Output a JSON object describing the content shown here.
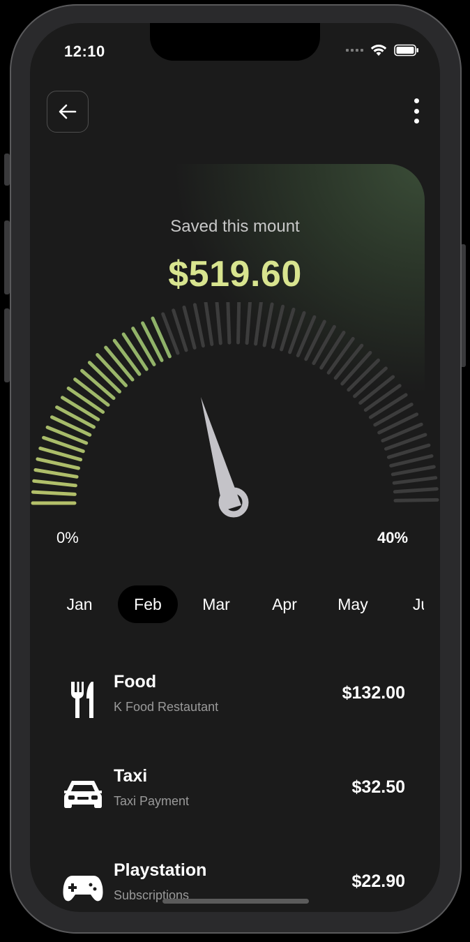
{
  "status_bar": {
    "time": "12:10"
  },
  "header": {
    "back_icon": "arrow-left-icon",
    "more_icon": "more-vertical-icon"
  },
  "summary": {
    "label": "Saved this mount",
    "amount": "$519.60",
    "accent_color": "#d8e48f",
    "gauge": {
      "min_label": "0%",
      "max_label": "40%",
      "filled_fraction": 0.38
    }
  },
  "months": {
    "items": [
      "Jan",
      "Feb",
      "Mar",
      "Apr",
      "May",
      "Ju"
    ],
    "selected": "Feb"
  },
  "transactions": [
    {
      "icon": "fork-knife-icon",
      "title": "Food",
      "subtitle": "K Food Restautant",
      "amount": "$132.00"
    },
    {
      "icon": "car-icon",
      "title": "Taxi",
      "subtitle": "Taxi Payment",
      "amount": "$32.50"
    },
    {
      "icon": "gamepad-icon",
      "title": "Playstation",
      "subtitle": "Subscriptions",
      "amount": "$22.90"
    }
  ]
}
